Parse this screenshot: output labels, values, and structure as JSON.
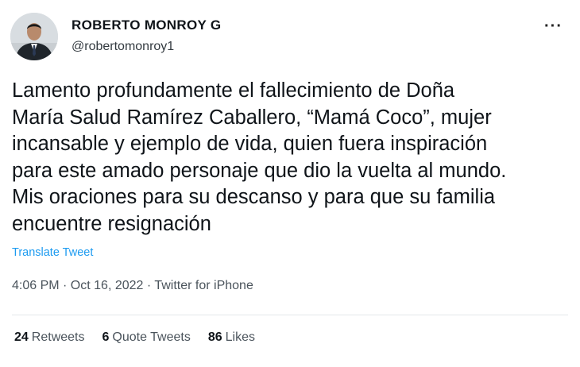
{
  "author": {
    "display_name": "ROBERTO MONROY G",
    "handle": "@robertomonroy1"
  },
  "more_menu_label": "···",
  "tweet": {
    "lines": [
      "Lamento profundamente el fallecimiento de Doña",
      "María Salud Ramírez Caballero, “Mamá Coco”, mujer",
      "incansable y ejemplo de vida, quien fuera inspiración",
      "para este amado personaje que dio la vuelta al mundo.",
      "Mis oraciones para su descanso y para que su familia",
      "encuentre resignación"
    ],
    "translate_label": "Translate Tweet",
    "timestamp": "4:06 PM · Oct 16, 2022 · Twitter for iPhone"
  },
  "stats": {
    "retweets": {
      "count": "24",
      "label": "Retweets"
    },
    "quote_tweets": {
      "count": "6",
      "label": "Quote Tweets"
    },
    "likes": {
      "count": "86",
      "label": "Likes"
    }
  }
}
